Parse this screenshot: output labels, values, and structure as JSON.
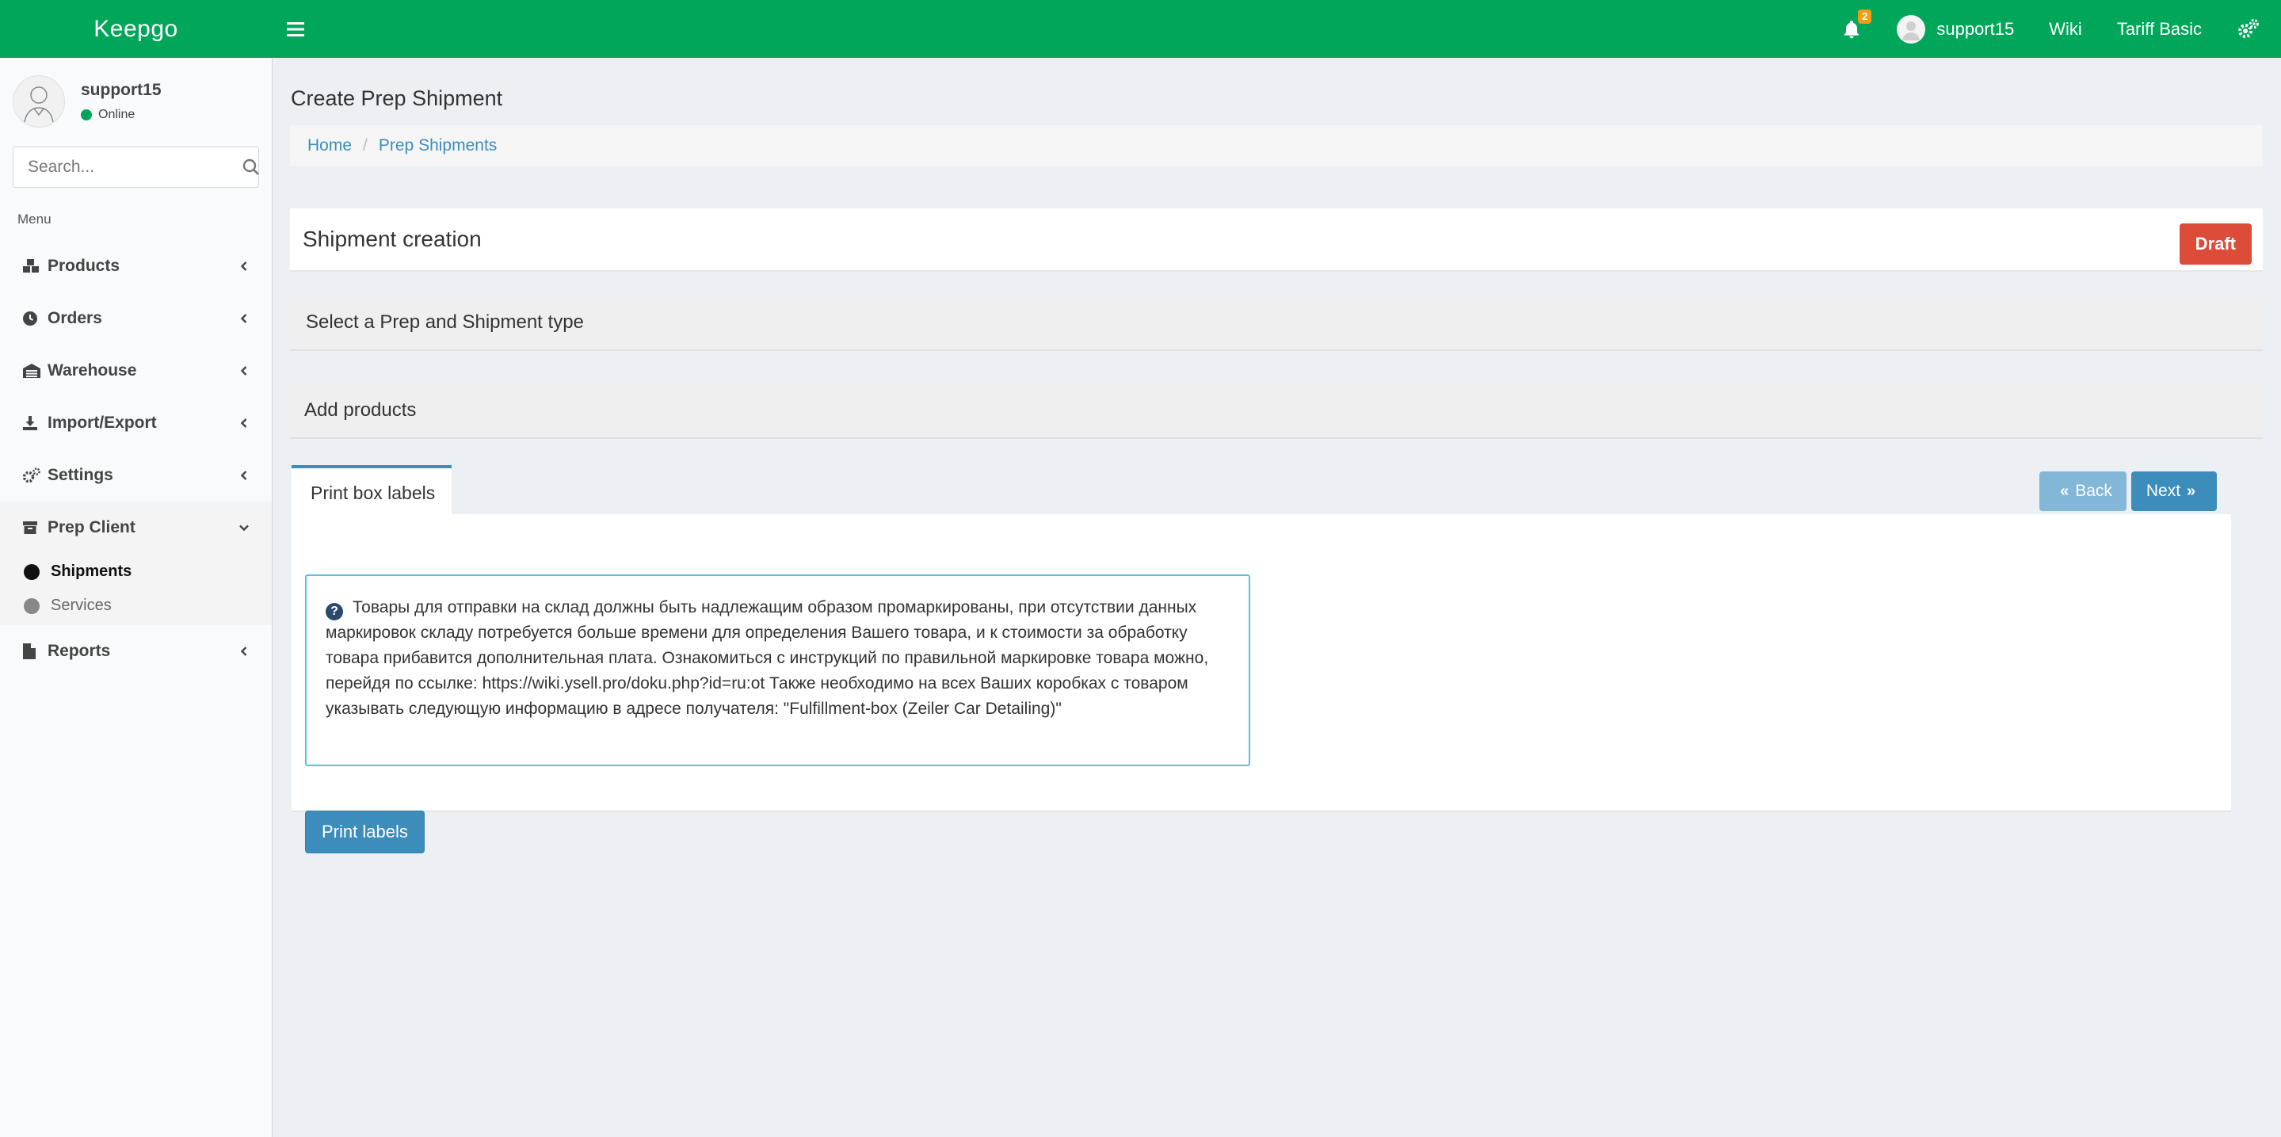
{
  "app": {
    "logo": "Keepgo"
  },
  "topbar": {
    "notifications_count": "2",
    "username": "support15",
    "wiki": "Wiki",
    "tariff": "Tariff Basic"
  },
  "sidebar": {
    "user": {
      "name": "support15",
      "status": "Online"
    },
    "search": {
      "placeholder": "Search..."
    },
    "menu_header": "Menu",
    "items": [
      {
        "label": "Products",
        "icon": "cubes-icon"
      },
      {
        "label": "Orders",
        "icon": "clock-icon"
      },
      {
        "label": "Warehouse",
        "icon": "warehouse-icon"
      },
      {
        "label": "Import/Export",
        "icon": "download-icon"
      },
      {
        "label": "Settings",
        "icon": "gears-icon"
      },
      {
        "label": "Prep Client",
        "icon": "archive-icon"
      },
      {
        "label": "Reports",
        "icon": "file-icon"
      }
    ],
    "prep_client_sub": [
      {
        "label": "Shipments",
        "active": true
      },
      {
        "label": "Services",
        "active": false
      }
    ]
  },
  "page": {
    "title": "Create Prep Shipment",
    "breadcrumb": [
      "Home",
      "Prep Shipments"
    ],
    "box_title": "Shipment creation",
    "status_label": "Draft",
    "steps": [
      "Select a Prep and Shipment type",
      "Add products"
    ],
    "active_tab": "Print box labels",
    "back_label": "Back",
    "next_label": "Next",
    "callout_text": "Товары для отправки на склад должны быть надлежащим образом промаркированы, при отсутствии данных маркировок складу потребуется больше времени для определения Вашего товара, и к стоимости за обработку товара прибавится дополнительная плата. Ознакомиться с инструкций по правильной маркировке товара можно, перейдя по ссылке: https://wiki.ysell.pro/doku.php?id=ru:ot Также необходимо на всех Ваших коробках с товаром указывать следующую информацию в адресе получателя: \"Fulfillment-box (Zeiler Car Detailing)\"",
    "print_button": "Print labels"
  },
  "colors": {
    "topbar": "#00a65a",
    "primary": "#3c8dbc",
    "danger": "#dd4b39",
    "info_border": "#5bc0de",
    "badge": "#f39c12"
  }
}
